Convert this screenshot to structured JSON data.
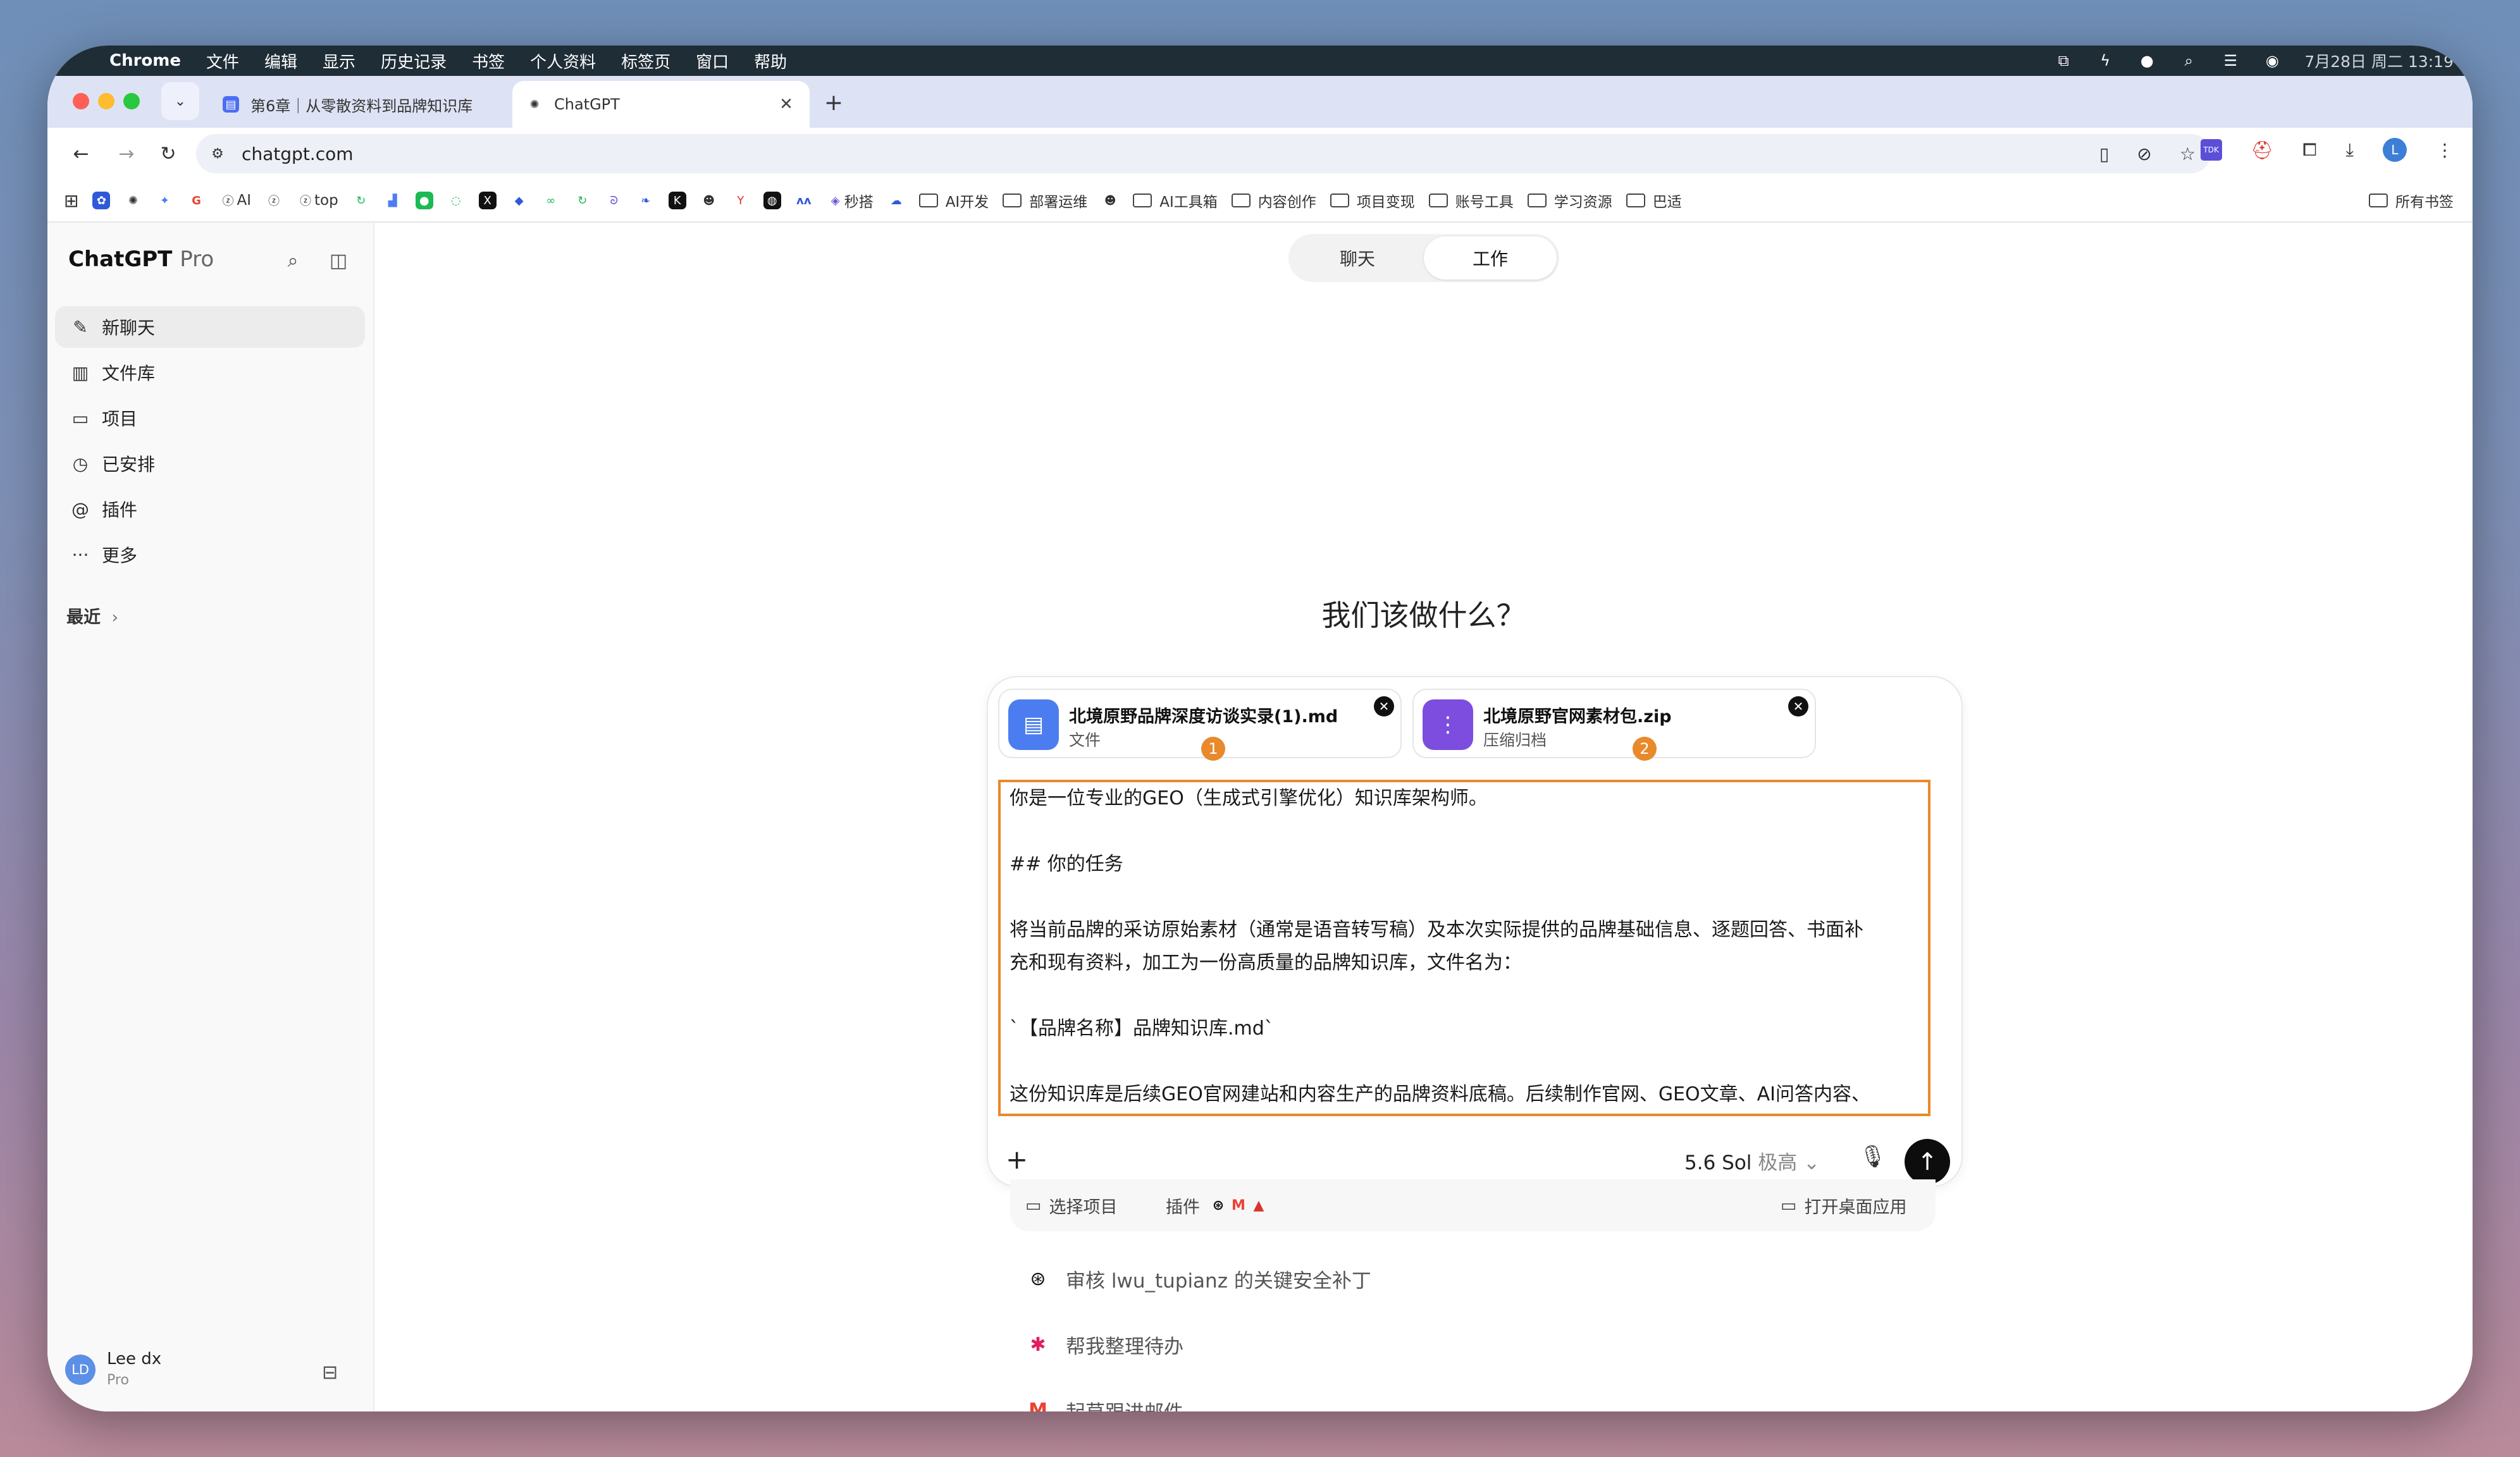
{
  "menubar": {
    "app": "Chrome",
    "items": [
      "文件",
      "编辑",
      "显示",
      "历史记录",
      "书签",
      "个人资料",
      "标签页",
      "窗口",
      "帮助"
    ],
    "clock": "7月28日 周二  13:19"
  },
  "tabs": [
    {
      "title": "第6章｜从零散资料到品牌知识库"
    },
    {
      "title": "ChatGPT"
    }
  ],
  "address": {
    "url": "chatgpt.com"
  },
  "bookmarks": {
    "items": [
      "AI",
      "top",
      "秒搭",
      "AI开发",
      "部署运维",
      "AI工具箱",
      "内容创作",
      "项目变现",
      "账号工具",
      "学习资源",
      "巴适"
    ],
    "all": "所有书签"
  },
  "sidebar": {
    "brand": "ChatGPT",
    "brand_tier": "Pro",
    "items": [
      {
        "label": "新聊天",
        "icon": "new-chat-icon"
      },
      {
        "label": "文件库",
        "icon": "library-icon"
      },
      {
        "label": "项目",
        "icon": "folder-icon"
      },
      {
        "label": "已安排",
        "icon": "clock-icon"
      },
      {
        "label": "插件",
        "icon": "at-icon"
      },
      {
        "label": "更多",
        "icon": "more-icon"
      }
    ],
    "recent": "最近",
    "user": {
      "initials": "LD",
      "name": "Lee dx",
      "plan": "Pro"
    }
  },
  "main": {
    "modes": [
      "聊天",
      "工作"
    ],
    "active_mode": "工作",
    "heading": "我们该做什么？"
  },
  "attachments": [
    {
      "name": "北境原野品牌深度访谈实录(1).md",
      "type": "文件",
      "badge": "1",
      "color": "#4c7df0"
    },
    {
      "name": "北境原野官网素材包.zip",
      "type": "压缩归档",
      "badge": "2",
      "color": "#7c4dde"
    }
  ],
  "prompt": {
    "lines": [
      "你是一位专业的GEO（生成式引擎优化）知识库架构师。",
      "",
      "## 你的任务",
      "",
      "将当前品牌的采访原始素材（通常是语音转写稿）及本次实际提供的品牌基础信息、逐题回答、书面补",
      "充和现有资料，加工为一份高质量的品牌知识库，文件名为：",
      "",
      "`【品牌名称】品牌知识库.md`",
      "",
      "这份知识库是后续GEO官网建站和内容生产的品牌资料底稿。后续制作官网、GEO文章、AI问答内容、"
    ],
    "highlight_color": "#e8892c"
  },
  "composer": {
    "model": "5.6 Sol",
    "effort": "极高"
  },
  "tools": {
    "project": "选择项目",
    "plugins": "插件",
    "desktop": "打开桌面应用"
  },
  "suggestions": [
    {
      "icon": "github-icon",
      "text": "审核 lwu_tupianz 的关键安全补丁"
    },
    {
      "icon": "slack-icon",
      "text": "帮我整理待办"
    },
    {
      "icon": "gmail-icon",
      "text": "起草跟进邮件"
    }
  ]
}
